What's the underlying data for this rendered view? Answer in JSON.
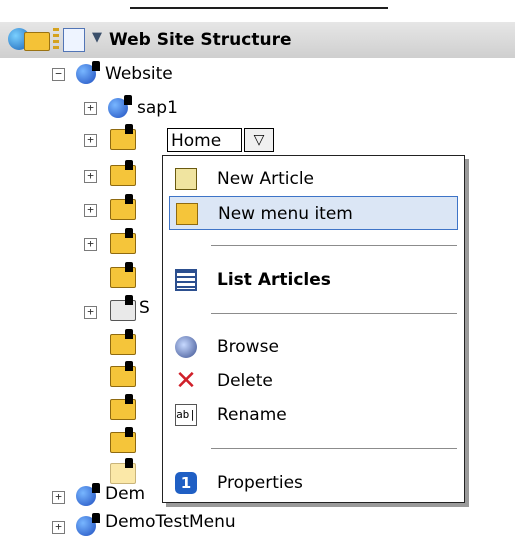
{
  "header": {
    "title": "Web Site Structure",
    "collapse_glyph": "▼"
  },
  "tree": {
    "root": {
      "label": "Website",
      "expander": "−"
    },
    "sap1": {
      "label": "sap1",
      "expander": "+"
    },
    "home_edit_value": "Home",
    "dropdown_glyph": "▽",
    "partial_s": "S",
    "partial_dem": "Dem",
    "demotestmenu": {
      "label": "DemoTestMenu",
      "expander": "+"
    }
  },
  "context_menu": {
    "items": [
      {
        "label": "New Article",
        "icon": "new-article-icon"
      },
      {
        "label": "New menu item",
        "icon": "new-menu-item-icon"
      },
      {
        "label": "List Articles",
        "icon": "list-articles-icon"
      },
      {
        "label": "Browse",
        "icon": "browse-icon"
      },
      {
        "label": "Delete",
        "icon": "delete-icon",
        "glyph": "✕"
      },
      {
        "label": "Rename",
        "icon": "rename-icon",
        "glyph": "ab|"
      },
      {
        "label": "Properties",
        "icon": "properties-icon",
        "glyph": "1"
      }
    ],
    "selected_index": 1
  },
  "colors": {
    "selection_bg": "#dbe6f5",
    "selection_border": "#3e74c7",
    "folder": "#f5c53a"
  }
}
